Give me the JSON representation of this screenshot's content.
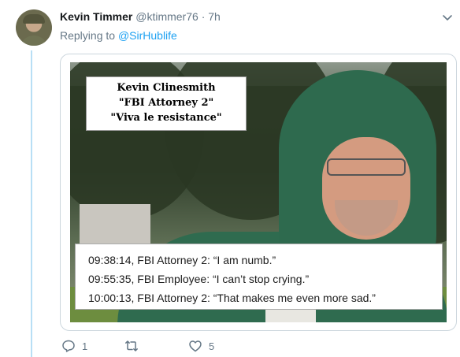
{
  "tweet": {
    "author_name": "Kevin Timmer",
    "handle": "@ktimmer76",
    "separator": "·",
    "time": "7h",
    "replying_prefix": "Replying to",
    "replying_to": "@SirHublife"
  },
  "image": {
    "caption_top": [
      "Kevin Clinesmith",
      "\"FBI Attorney 2\"",
      "\"Viva le resistance\""
    ],
    "caption_lines": [
      "09:38:14, FBI Attorney 2:  “I am numb.”",
      "09:55:35, FBI Employee:  “I can’t stop crying.”",
      "10:00:13, FBI Attorney 2:  “That makes me even more sad.”"
    ]
  },
  "actions": {
    "reply_count": "1",
    "retweet_count": "",
    "like_count": "5"
  },
  "colors": {
    "accent": "#1da1f2",
    "muted": "#657786",
    "thread_line": "#b8dff5"
  },
  "icons": [
    "chevron-down-icon",
    "reply-icon",
    "retweet-icon",
    "like-icon"
  ]
}
